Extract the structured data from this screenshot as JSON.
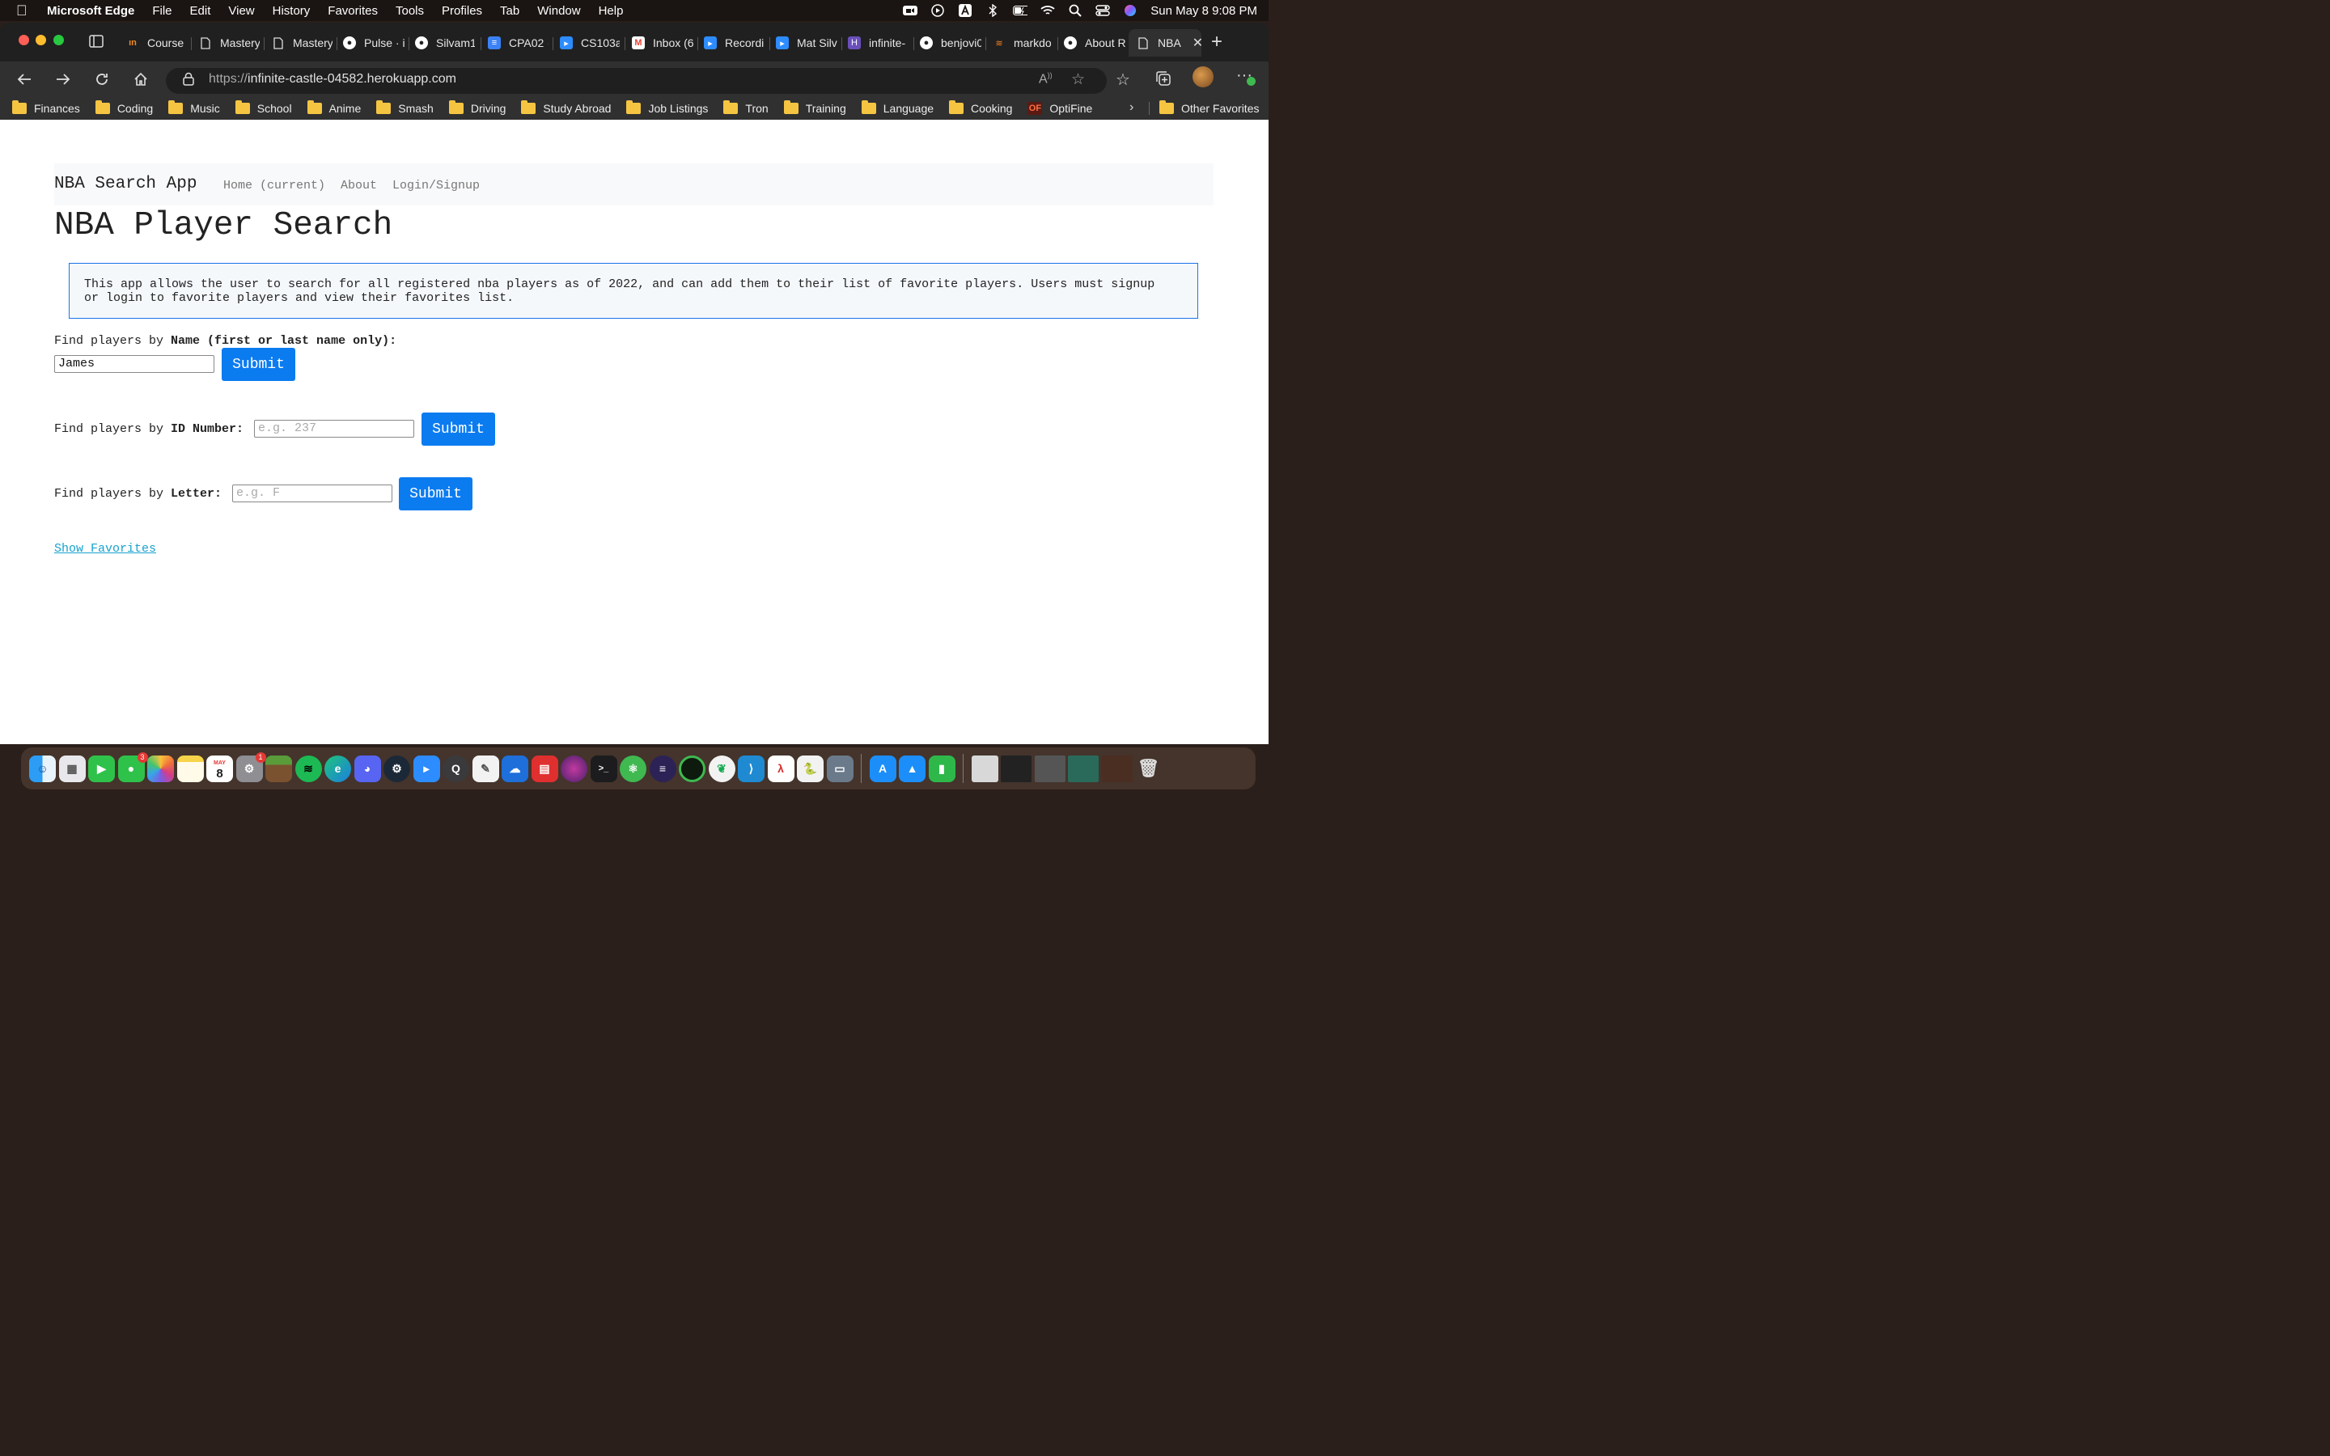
{
  "menubar": {
    "app": "Microsoft Edge",
    "items": [
      "File",
      "Edit",
      "View",
      "History",
      "Favorites",
      "Tools",
      "Profiles",
      "Tab",
      "Window",
      "Help"
    ],
    "clock": "Sun May 8  9:08 PM"
  },
  "tabs": [
    {
      "label": "Course",
      "icon": "coursera-icon",
      "color": "#f08a24"
    },
    {
      "label": "Mastery",
      "icon": "page-icon",
      "color": "#444"
    },
    {
      "label": "Mastery",
      "icon": "page-icon",
      "color": "#444"
    },
    {
      "label": "Pulse · i",
      "icon": "github-icon",
      "color": "#222"
    },
    {
      "label": "Silvam1",
      "icon": "github-icon",
      "color": "#222"
    },
    {
      "label": "CPA02 ·",
      "icon": "docs-icon",
      "color": "#3b82f6"
    },
    {
      "label": "CS103a",
      "icon": "zoom-icon",
      "color": "#2d8cff"
    },
    {
      "label": "Inbox (6",
      "icon": "gmail-icon",
      "color": "#ea4335"
    },
    {
      "label": "Recordi",
      "icon": "zoom-icon",
      "color": "#2d8cff"
    },
    {
      "label": "Mat Silv",
      "icon": "zoom-icon",
      "color": "#2d8cff"
    },
    {
      "label": "infinite-",
      "icon": "heroku-icon",
      "color": "#6b4fbb"
    },
    {
      "label": "benjovi0",
      "icon": "github-icon",
      "color": "#222"
    },
    {
      "label": "markdo",
      "icon": "stackoverflow-icon",
      "color": "#f48024"
    },
    {
      "label": "About R",
      "icon": "github-icon",
      "color": "#222"
    },
    {
      "label": "NBA",
      "icon": "page-icon",
      "color": "#444"
    }
  ],
  "address": {
    "scheme": "https://",
    "host": "infinite-castle-04582.herokuapp.com"
  },
  "bookmarks": [
    "Finances",
    "Coding",
    "Music",
    "School",
    "Anime",
    "Smash",
    "Driving",
    "Study Abroad",
    "Job Listings",
    "Tron",
    "Training",
    "Language",
    "Cooking",
    "OptiFine"
  ],
  "other_favorites": "Other Favorites",
  "page": {
    "brand": "NBA Search App",
    "nav": [
      "Home (current)",
      "About",
      "Login/Signup"
    ],
    "title": "NBA Player Search",
    "info_line1": "This app allows the user to search for all registered nba players as of 2022, and can add them to their list of favorite players. Users must signup",
    "info_line2": "or login to favorite players and view their favorites list.",
    "form_name": {
      "prefix": "Find players by ",
      "bold": "Name (first or last name only):",
      "value": "James",
      "button": "Submit"
    },
    "form_id": {
      "prefix": "Find players by ",
      "bold": "ID Number:",
      "placeholder": "e.g. 237",
      "button": "Submit"
    },
    "form_letter": {
      "prefix": "Find players by ",
      "bold": "Letter:",
      "placeholder": "e.g. F",
      "button": "Submit"
    },
    "show_favorites": "Show Favorites"
  },
  "dock": {
    "messages_badge": "3",
    "settings_badge": "1",
    "calendar_month": "MAY",
    "calendar_day": "8"
  }
}
